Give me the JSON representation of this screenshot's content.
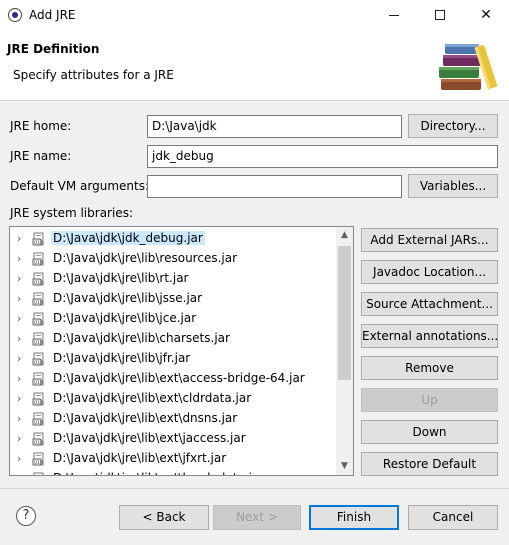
{
  "window": {
    "title": "Add JRE",
    "minimize": "—",
    "maximize": "☐",
    "close": "✕"
  },
  "header": {
    "title": "JRE Definition",
    "subtitle": "Specify attributes for a JRE"
  },
  "form": {
    "jre_home_label": "JRE home:",
    "jre_home_value": "D:\\Java\\jdk",
    "directory_button": "Directory...",
    "jre_name_label": "JRE name:",
    "jre_name_value": "jdk_debug",
    "vm_args_label": "Default VM arguments:",
    "vm_args_value": "",
    "variables_button": "Variables...",
    "libraries_label": "JRE system libraries:"
  },
  "libraries": [
    "D:\\Java\\jdk\\jdk_debug.jar",
    "D:\\Java\\jdk\\jre\\lib\\resources.jar",
    "D:\\Java\\jdk\\jre\\lib\\rt.jar",
    "D:\\Java\\jdk\\jre\\lib\\jsse.jar",
    "D:\\Java\\jdk\\jre\\lib\\jce.jar",
    "D:\\Java\\jdk\\jre\\lib\\charsets.jar",
    "D:\\Java\\jdk\\jre\\lib\\jfr.jar",
    "D:\\Java\\jdk\\jre\\lib\\ext\\access-bridge-64.jar",
    "D:\\Java\\jdk\\jre\\lib\\ext\\cldrdata.jar",
    "D:\\Java\\jdk\\jre\\lib\\ext\\dnsns.jar",
    "D:\\Java\\jdk\\jre\\lib\\ext\\jaccess.jar",
    "D:\\Java\\jdk\\jre\\lib\\ext\\jfxrt.jar",
    "D:\\Java\\jdk\\jre\\lib\\ext\\localedata.jar"
  ],
  "side_buttons": {
    "add_external_jars": "Add External JARs...",
    "javadoc_location": "Javadoc Location...",
    "source_attachment": "Source Attachment...",
    "external_annotations": "External annotations...",
    "remove": "Remove",
    "up": "Up",
    "down": "Down",
    "restore_default": "Restore Default"
  },
  "footer": {
    "help": "?",
    "back": "< Back",
    "next": "Next >",
    "finish": "Finish",
    "cancel": "Cancel"
  },
  "colors": {
    "selection": "#cce8ff",
    "primary_border": "#0078d7"
  }
}
